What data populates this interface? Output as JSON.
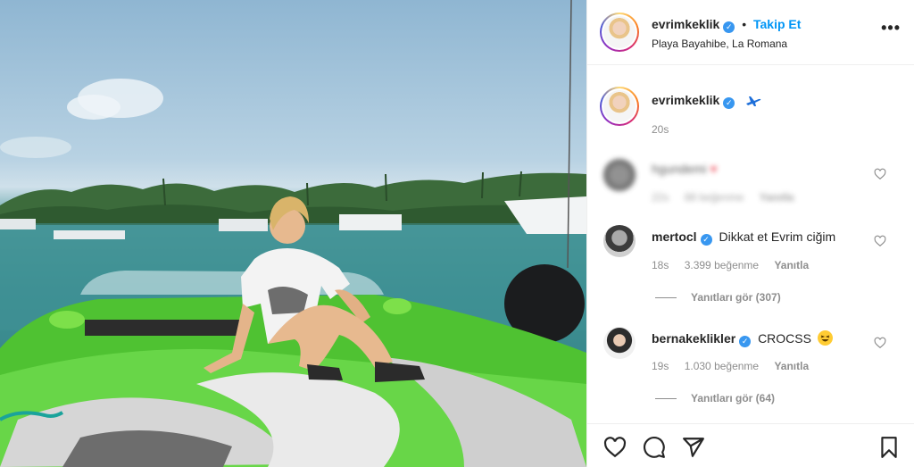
{
  "post": {
    "username": "evrimkeklik",
    "follow_label": "Takip Et",
    "separator": "•",
    "location": "Playa Bayahibe, La Romana",
    "more_label": "•••"
  },
  "caption": {
    "username": "evrimkeklik",
    "time": "20s"
  },
  "comments": [
    {
      "username": "hgundemi",
      "text": "",
      "time": "22s",
      "likes": "88 beğenme",
      "reply": "Yanıtla",
      "blurred": true
    },
    {
      "username": "mertocl",
      "text": "Dikkat et Evrim ciğim",
      "time": "18s",
      "likes": "3.399 beğenme",
      "reply": "Yanıtla",
      "view_replies": "Yanıtları gör (307)"
    },
    {
      "username": "bernakeklikler",
      "text": "CROCSS",
      "time": "19s",
      "likes": "1.030 beğenme",
      "reply": "Yanıtla",
      "view_replies": "Yanıtları gör (64)"
    }
  ],
  "colors": {
    "accent": "#0095f6",
    "verified": "#3897f0",
    "muted": "#8e8e8e",
    "heart_red": "#ed4956",
    "boat_green": "#5fd13a"
  },
  "icons": [
    "verified-badge-icon",
    "airplane-icon",
    "heart-icon",
    "comment-icon",
    "share-icon",
    "bookmark-icon",
    "more-icon"
  ]
}
